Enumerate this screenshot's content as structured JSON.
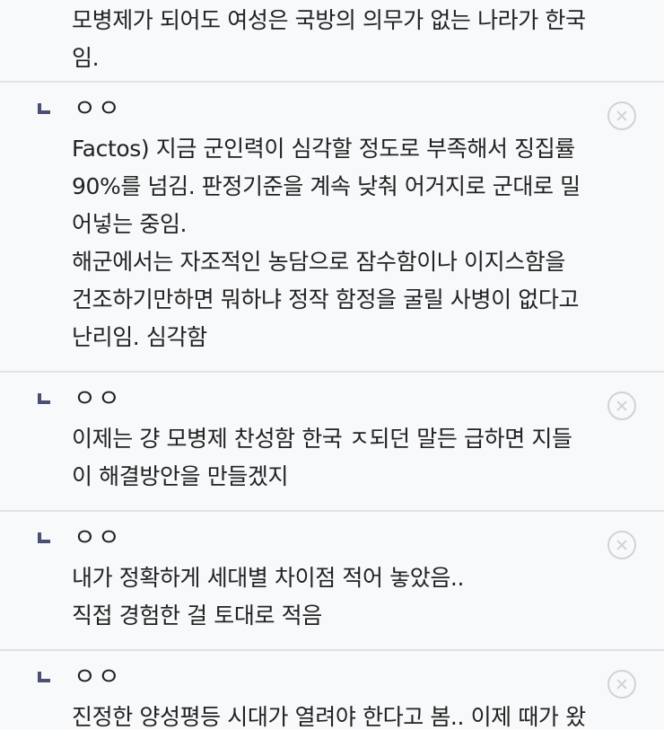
{
  "top_comment": {
    "text": "모병제가 되어도 여성은 국방의 의무가 없는 나라가 한국\n임."
  },
  "replies": [
    {
      "author": "ㅇㅇ",
      "text": "Factos) 지금 군인력이 심각할 정도로 부족해서 징집률\n90%를 넘김. 판정기준을 계속 낮춰 어거지로 군대로 밀\n어넣는 중임.\n해군에서는 자조적인 농담으로 잠수함이나 이지스함을\n건조하기만하면 뭐하냐 정작 함정을 굴릴 사병이 없다고\n난리임. 심각함",
      "delete_icon": "close-circle-icon"
    },
    {
      "author": "ㅇㅇ",
      "text": "이제는 걍 모병제 찬성함 한국 ㅈ되던 말든 급하면 지들\n이 해결방안을 만들겠지",
      "delete_icon": "close-circle-icon"
    },
    {
      "author": "ㅇㅇ",
      "text": "내가 정확하게 세대별 차이점 적어 놓았음..\n직접 경험한 걸 토대로 적음",
      "delete_icon": "close-circle-icon"
    },
    {
      "author": "ㅇㅇ",
      "text": "진정한 양성평등 시대가 열려야 한다고 봄.. 이제 때가 왔",
      "delete_icon": "close-circle-icon"
    }
  ],
  "colors": {
    "background": "#f8f9fb",
    "divider": "#dfe2e7",
    "reply_marker": "#4a4f73",
    "delete_icon": "#cfd3d9",
    "text": "#222222"
  }
}
